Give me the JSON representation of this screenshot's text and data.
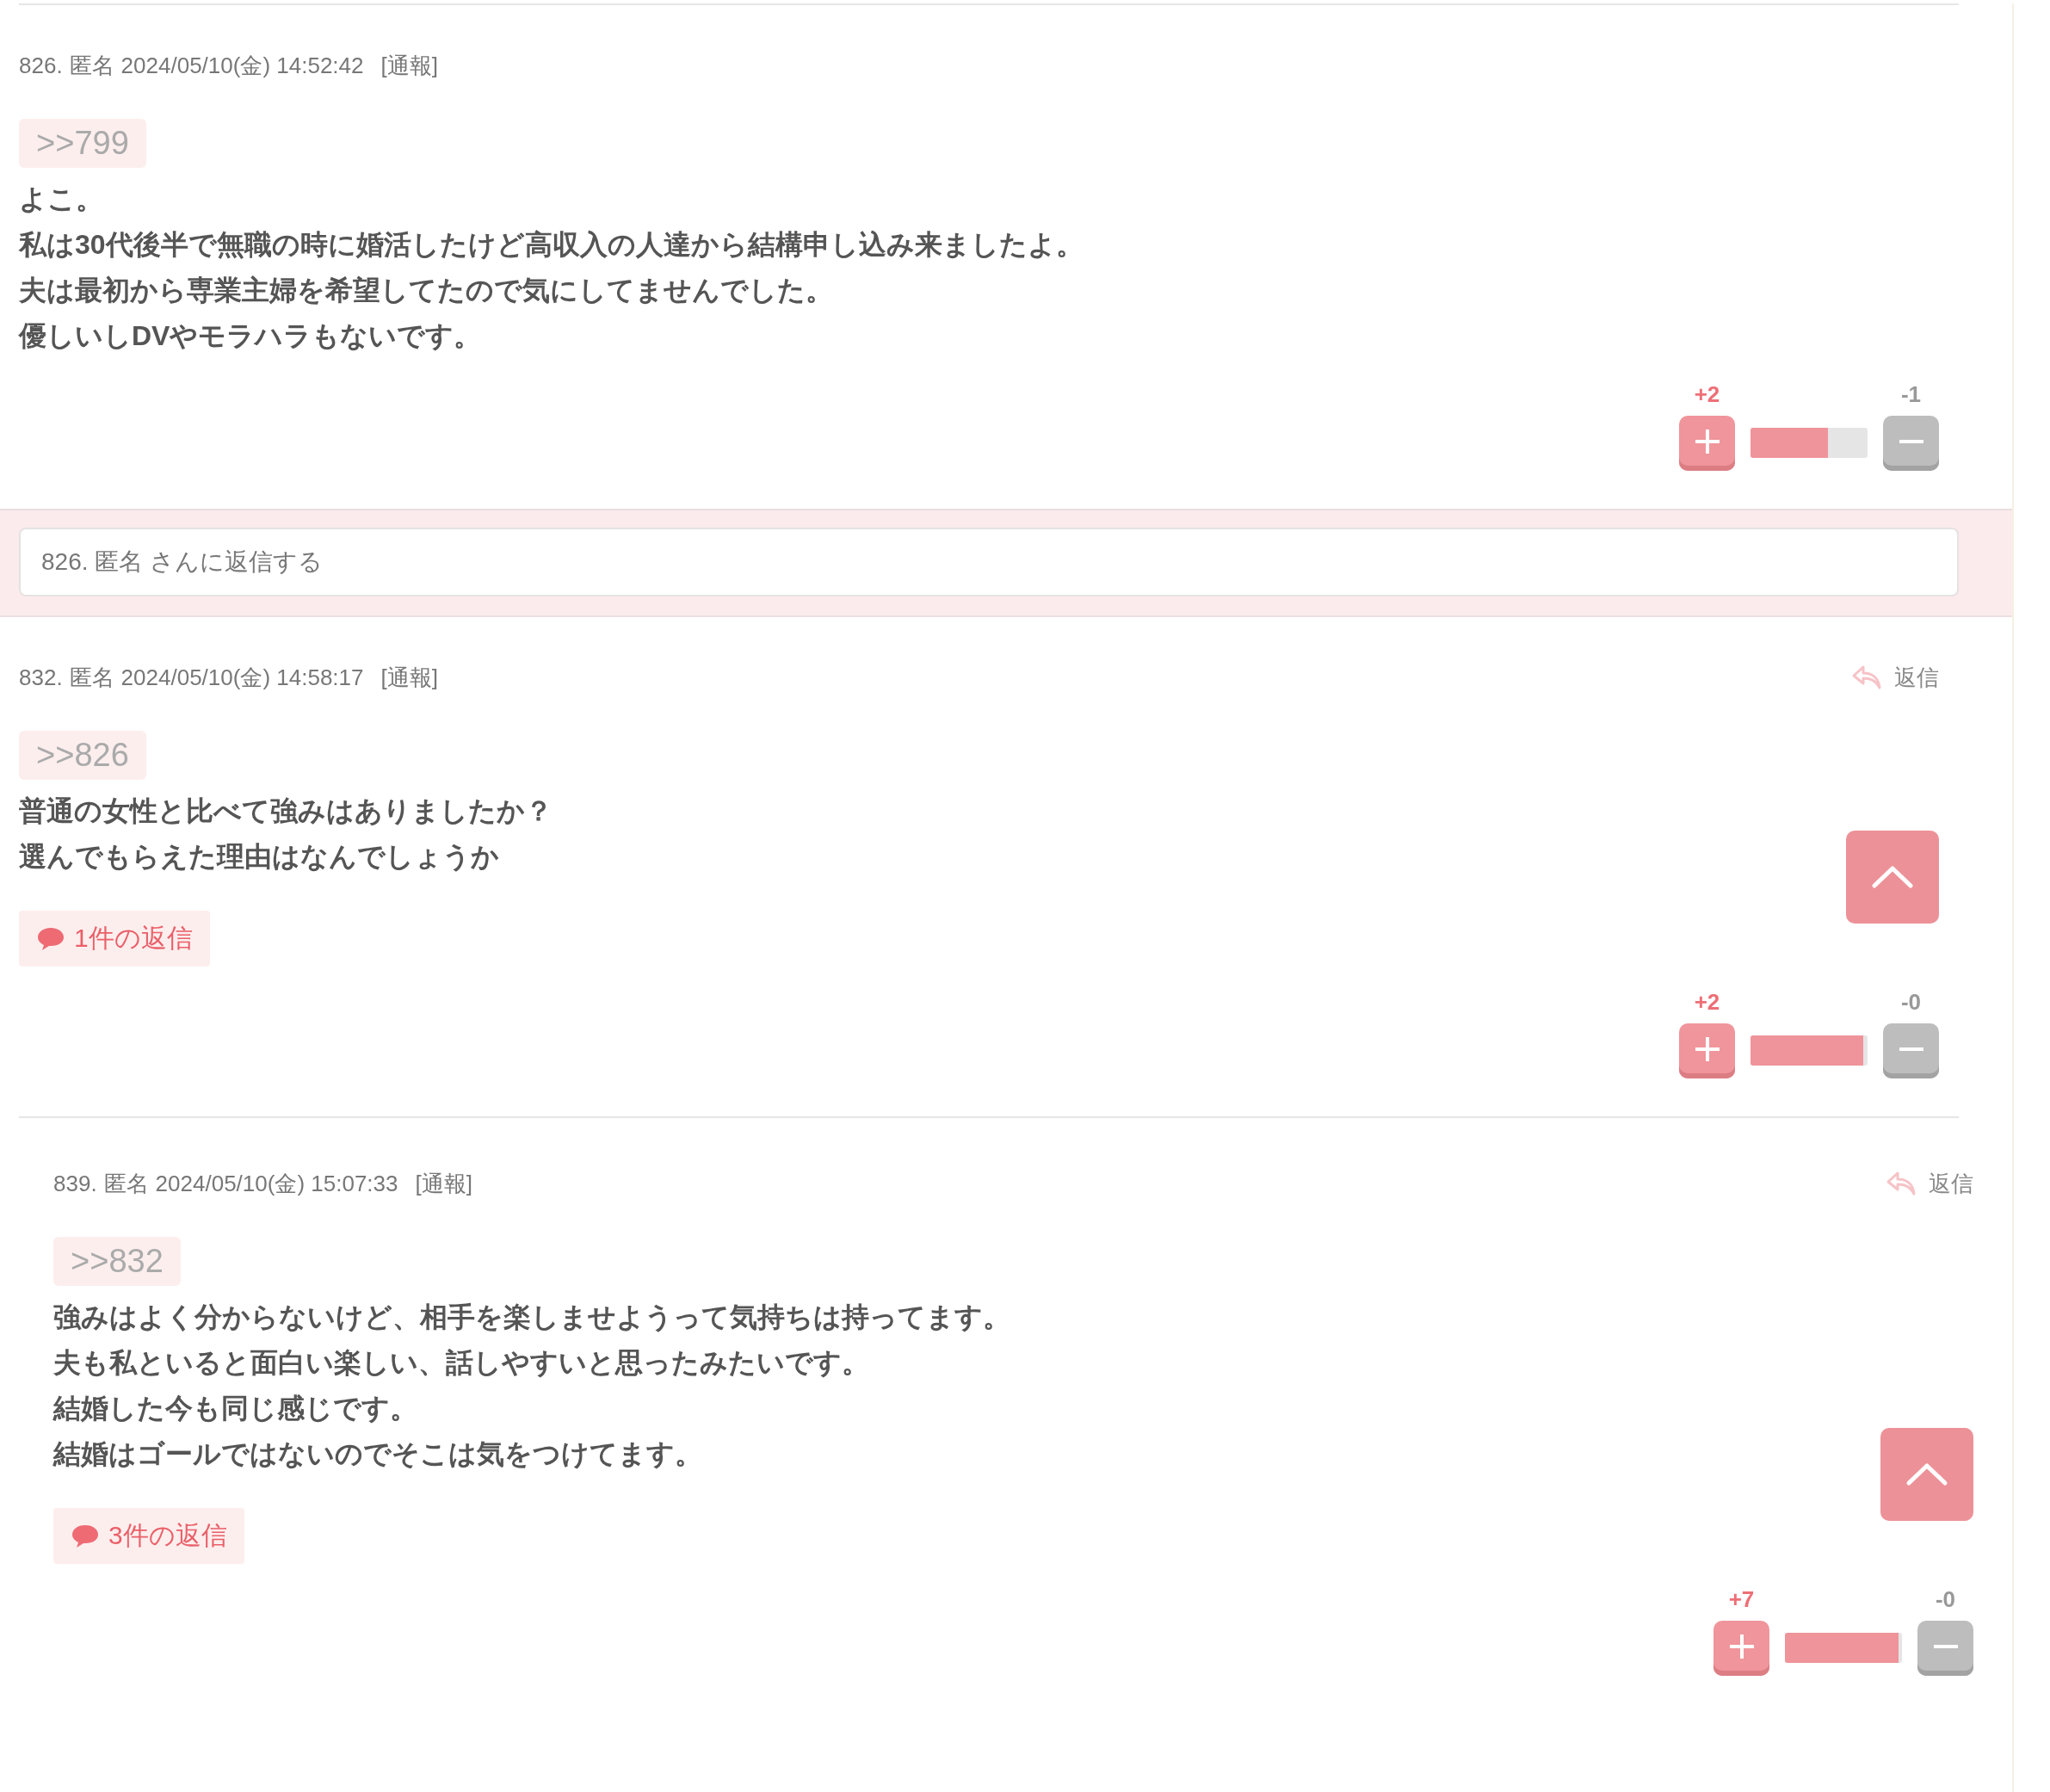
{
  "posts": [
    {
      "number": "826.",
      "author": "匿名",
      "date": "2024/05/10(金) 14:52:42",
      "report": "[通報]",
      "anchor": ">>799",
      "body": [
        "よこ。",
        "私は30代後半で無職の時に婚活したけど高収入の人達から結構申し込み来ましたよ。",
        "夫は最初から専業主婦を希望してたので気にしてませんでした。",
        "優しいしDVやモラハラもないです。"
      ],
      "votes": {
        "plus": "+2",
        "minus": "-1",
        "level": 0.66
      },
      "reply_form": {
        "placeholder": "826. 匿名 さんに返信する"
      }
    },
    {
      "number": "832.",
      "author": "匿名",
      "date": "2024/05/10(金) 14:58:17",
      "report": "[通報]",
      "reply_link": "返信",
      "anchor": ">>826",
      "body": [
        "普通の女性と比べて強みはありましたか？",
        "選んでもらえた理由はなんでしょうか"
      ],
      "replies": "1件の返信",
      "scroll_top": true,
      "votes": {
        "plus": "+2",
        "minus": "-0",
        "level": 0.96
      },
      "children": [
        {
          "number": "839.",
          "author": "匿名",
          "date": "2024/05/10(金) 15:07:33",
          "report": "[通報]",
          "reply_link": "返信",
          "anchor": ">>832",
          "body": [
            "強みはよく分からないけど、相手を楽しませようって気持ちは持ってます。",
            "夫も私といると面白い楽しい、話しやすいと思ったみたいです。",
            "結婚した今も同じ感じです。",
            "結婚はゴールではないのでそこは気をつけてます。"
          ],
          "replies": "3件の返信",
          "scroll_top": true,
          "votes": {
            "plus": "+7",
            "minus": "-0",
            "level": 0.97
          }
        }
      ]
    }
  ]
}
